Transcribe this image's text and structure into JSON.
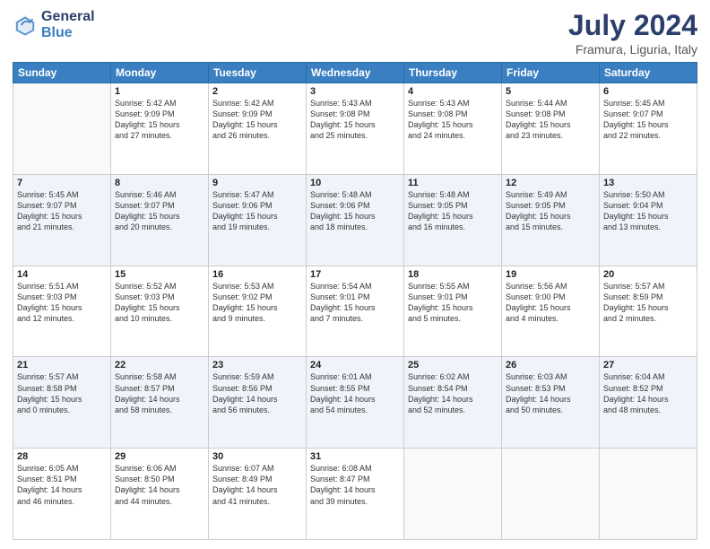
{
  "logo": {
    "general": "General",
    "blue": "Blue"
  },
  "title": "July 2024",
  "location": "Framura, Liguria, Italy",
  "days_of_week": [
    "Sunday",
    "Monday",
    "Tuesday",
    "Wednesday",
    "Thursday",
    "Friday",
    "Saturday"
  ],
  "weeks": [
    [
      {
        "day": "",
        "info": ""
      },
      {
        "day": "1",
        "info": "Sunrise: 5:42 AM\nSunset: 9:09 PM\nDaylight: 15 hours\nand 27 minutes."
      },
      {
        "day": "2",
        "info": "Sunrise: 5:42 AM\nSunset: 9:09 PM\nDaylight: 15 hours\nand 26 minutes."
      },
      {
        "day": "3",
        "info": "Sunrise: 5:43 AM\nSunset: 9:08 PM\nDaylight: 15 hours\nand 25 minutes."
      },
      {
        "day": "4",
        "info": "Sunrise: 5:43 AM\nSunset: 9:08 PM\nDaylight: 15 hours\nand 24 minutes."
      },
      {
        "day": "5",
        "info": "Sunrise: 5:44 AM\nSunset: 9:08 PM\nDaylight: 15 hours\nand 23 minutes."
      },
      {
        "day": "6",
        "info": "Sunrise: 5:45 AM\nSunset: 9:07 PM\nDaylight: 15 hours\nand 22 minutes."
      }
    ],
    [
      {
        "day": "7",
        "info": "Sunrise: 5:45 AM\nSunset: 9:07 PM\nDaylight: 15 hours\nand 21 minutes."
      },
      {
        "day": "8",
        "info": "Sunrise: 5:46 AM\nSunset: 9:07 PM\nDaylight: 15 hours\nand 20 minutes."
      },
      {
        "day": "9",
        "info": "Sunrise: 5:47 AM\nSunset: 9:06 PM\nDaylight: 15 hours\nand 19 minutes."
      },
      {
        "day": "10",
        "info": "Sunrise: 5:48 AM\nSunset: 9:06 PM\nDaylight: 15 hours\nand 18 minutes."
      },
      {
        "day": "11",
        "info": "Sunrise: 5:48 AM\nSunset: 9:05 PM\nDaylight: 15 hours\nand 16 minutes."
      },
      {
        "day": "12",
        "info": "Sunrise: 5:49 AM\nSunset: 9:05 PM\nDaylight: 15 hours\nand 15 minutes."
      },
      {
        "day": "13",
        "info": "Sunrise: 5:50 AM\nSunset: 9:04 PM\nDaylight: 15 hours\nand 13 minutes."
      }
    ],
    [
      {
        "day": "14",
        "info": "Sunrise: 5:51 AM\nSunset: 9:03 PM\nDaylight: 15 hours\nand 12 minutes."
      },
      {
        "day": "15",
        "info": "Sunrise: 5:52 AM\nSunset: 9:03 PM\nDaylight: 15 hours\nand 10 minutes."
      },
      {
        "day": "16",
        "info": "Sunrise: 5:53 AM\nSunset: 9:02 PM\nDaylight: 15 hours\nand 9 minutes."
      },
      {
        "day": "17",
        "info": "Sunrise: 5:54 AM\nSunset: 9:01 PM\nDaylight: 15 hours\nand 7 minutes."
      },
      {
        "day": "18",
        "info": "Sunrise: 5:55 AM\nSunset: 9:01 PM\nDaylight: 15 hours\nand 5 minutes."
      },
      {
        "day": "19",
        "info": "Sunrise: 5:56 AM\nSunset: 9:00 PM\nDaylight: 15 hours\nand 4 minutes."
      },
      {
        "day": "20",
        "info": "Sunrise: 5:57 AM\nSunset: 8:59 PM\nDaylight: 15 hours\nand 2 minutes."
      }
    ],
    [
      {
        "day": "21",
        "info": "Sunrise: 5:57 AM\nSunset: 8:58 PM\nDaylight: 15 hours\nand 0 minutes."
      },
      {
        "day": "22",
        "info": "Sunrise: 5:58 AM\nSunset: 8:57 PM\nDaylight: 14 hours\nand 58 minutes."
      },
      {
        "day": "23",
        "info": "Sunrise: 5:59 AM\nSunset: 8:56 PM\nDaylight: 14 hours\nand 56 minutes."
      },
      {
        "day": "24",
        "info": "Sunrise: 6:01 AM\nSunset: 8:55 PM\nDaylight: 14 hours\nand 54 minutes."
      },
      {
        "day": "25",
        "info": "Sunrise: 6:02 AM\nSunset: 8:54 PM\nDaylight: 14 hours\nand 52 minutes."
      },
      {
        "day": "26",
        "info": "Sunrise: 6:03 AM\nSunset: 8:53 PM\nDaylight: 14 hours\nand 50 minutes."
      },
      {
        "day": "27",
        "info": "Sunrise: 6:04 AM\nSunset: 8:52 PM\nDaylight: 14 hours\nand 48 minutes."
      }
    ],
    [
      {
        "day": "28",
        "info": "Sunrise: 6:05 AM\nSunset: 8:51 PM\nDaylight: 14 hours\nand 46 minutes."
      },
      {
        "day": "29",
        "info": "Sunrise: 6:06 AM\nSunset: 8:50 PM\nDaylight: 14 hours\nand 44 minutes."
      },
      {
        "day": "30",
        "info": "Sunrise: 6:07 AM\nSunset: 8:49 PM\nDaylight: 14 hours\nand 41 minutes."
      },
      {
        "day": "31",
        "info": "Sunrise: 6:08 AM\nSunset: 8:47 PM\nDaylight: 14 hours\nand 39 minutes."
      },
      {
        "day": "",
        "info": ""
      },
      {
        "day": "",
        "info": ""
      },
      {
        "day": "",
        "info": ""
      }
    ]
  ]
}
